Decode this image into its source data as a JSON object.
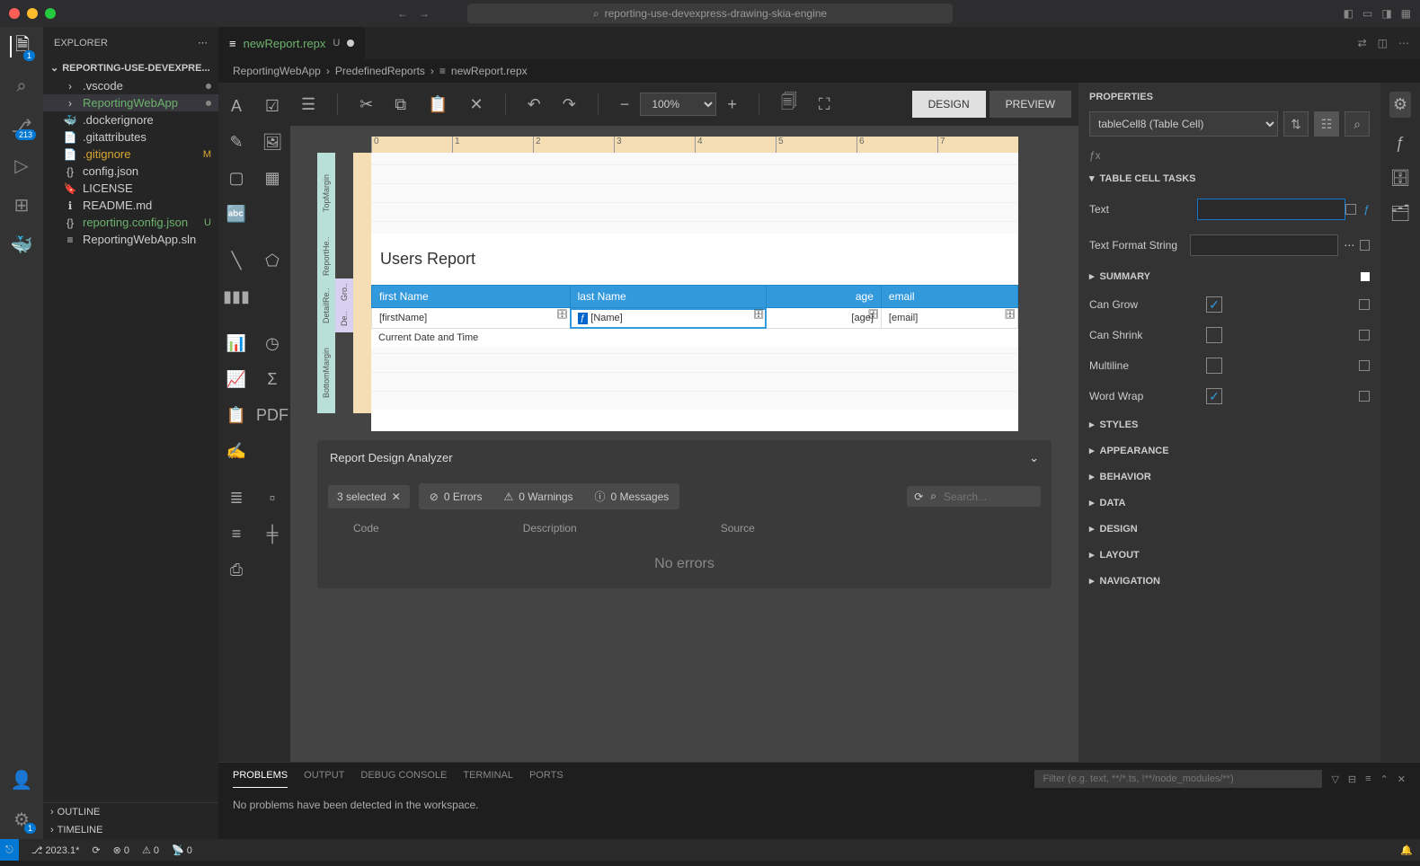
{
  "titlebar": {
    "search": "reporting-use-devexpress-drawing-skia-engine"
  },
  "activity": {
    "explorer_badge": "1",
    "scm_badge": "213"
  },
  "sidebar": {
    "title": "EXPLORER",
    "section": "REPORTING-USE-DEVEXPRE...",
    "items": [
      {
        "icon": "›",
        "name": ".vscode",
        "mod": true
      },
      {
        "icon": "›",
        "name": "ReportingWebApp",
        "mod": true,
        "green": true,
        "sel": true
      },
      {
        "icon": "🐳",
        "name": ".dockerignore"
      },
      {
        "icon": "📄",
        "name": ".gitattributes"
      },
      {
        "icon": "📄",
        "name": ".gitignore",
        "tag": "M",
        "yellow": true
      },
      {
        "icon": "{}",
        "name": "config.json"
      },
      {
        "icon": "🔖",
        "name": "LICENSE"
      },
      {
        "icon": "ℹ",
        "name": "README.md"
      },
      {
        "icon": "{}",
        "name": "reporting.config.json",
        "tag": "U",
        "green": true
      },
      {
        "icon": "≡",
        "name": "ReportingWebApp.sln"
      }
    ],
    "outline": "OUTLINE",
    "timeline": "TIMELINE"
  },
  "tab": {
    "name": "newReport.repx",
    "status": "U"
  },
  "crumbs": [
    "ReportingWebApp",
    "PredefinedReports",
    "newReport.repx"
  ],
  "toolbar": {
    "zoom": "100%",
    "design": "DESIGN",
    "preview": "PREVIEW"
  },
  "report": {
    "title": "Users Report",
    "headers": [
      "first Name",
      "last Name",
      "age",
      "email"
    ],
    "cells": [
      "[firstName]",
      "[Name]",
      "[age]",
      "[email]"
    ],
    "footer": "Current Date and Time",
    "ruler": [
      "0",
      "1",
      "2",
      "3",
      "4",
      "5",
      "6",
      "7"
    ],
    "bands": {
      "outer": [
        "TopMargin",
        "ReportHe..",
        "DetailRe..",
        "BottomMargin"
      ],
      "mid": [
        "De..",
        "Gro.."
      ]
    }
  },
  "analyzer": {
    "title": "Report Design Analyzer",
    "selected": "3 selected",
    "errors": "0 Errors",
    "warnings": "0 Warnings",
    "messages": "0 Messages",
    "search_ph": "Search...",
    "cols": [
      "Code",
      "Description",
      "Source"
    ],
    "empty": "No errors"
  },
  "props": {
    "title": "PROPERTIES",
    "element": "tableCell8 (Table Cell)",
    "sections": {
      "tasks": "TABLE CELL TASKS",
      "summary": "SUMMARY",
      "styles": "STYLES",
      "appearance": "APPEARANCE",
      "behavior": "BEHAVIOR",
      "data": "DATA",
      "design": "DESIGN",
      "layout": "LAYOUT",
      "navigation": "NAVIGATION"
    },
    "fields": {
      "text": "Text",
      "format": "Text Format String",
      "grow": "Can Grow",
      "shrink": "Can Shrink",
      "multi": "Multiline",
      "wrap": "Word Wrap"
    }
  },
  "panel": {
    "tabs": [
      "PROBLEMS",
      "OUTPUT",
      "DEBUG CONSOLE",
      "TERMINAL",
      "PORTS"
    ],
    "filter_ph": "Filter (e.g. text, **/*.ts, !**/node_modules/**)",
    "body": "No problems have been detected in the workspace."
  },
  "status": {
    "branch": "2023.1*",
    "sync": "⟳",
    "err": "⊗ 0",
    "warn": "⚠ 0",
    "port": "📡 0",
    "bell": "🔔"
  }
}
